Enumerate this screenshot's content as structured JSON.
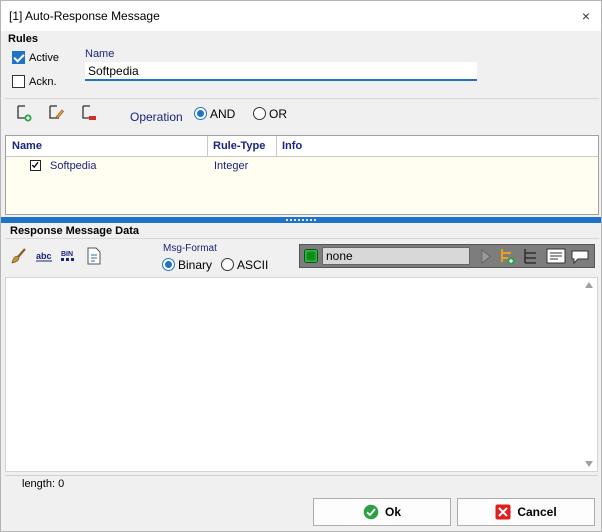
{
  "window": {
    "title": "[1] Auto-Response Message",
    "close_glyph": "×"
  },
  "rules": {
    "section_label": "Rules",
    "active_label": "Active",
    "active_checked": true,
    "ackn_label": "Ackn.",
    "ackn_checked": false,
    "name_label": "Name",
    "name_value": "Softpedia"
  },
  "toolbar": {
    "icons": [
      "add-rule-icon",
      "edit-rule-icon",
      "delete-rule-icon"
    ],
    "operation_label": "Operation",
    "op_and": "AND",
    "op_or": "OR",
    "selected_op": "AND"
  },
  "grid": {
    "columns": [
      "Name",
      "Rule-Type",
      "Info"
    ],
    "rows": [
      {
        "checked": true,
        "name": "Softpedia",
        "rule_type": "Integer",
        "info": ""
      }
    ]
  },
  "response": {
    "section_label": "Response Message Data",
    "tool_icons": [
      "brush-icon",
      "abc-icon",
      "bin-icon",
      "file-icon"
    ],
    "msg_format_label": "Msg-Format",
    "binary_label": "Binary",
    "ascii_label": "ASCII",
    "selected_format": "Binary",
    "sequence_value": "none",
    "text": ""
  },
  "status": {
    "length_label": "length: 0"
  },
  "buttons": {
    "ok": "Ok",
    "cancel": "Cancel"
  },
  "colors": {
    "accent": "#1e73c8",
    "label_navy": "#1a237e",
    "grid_bg": "#fffef0"
  }
}
